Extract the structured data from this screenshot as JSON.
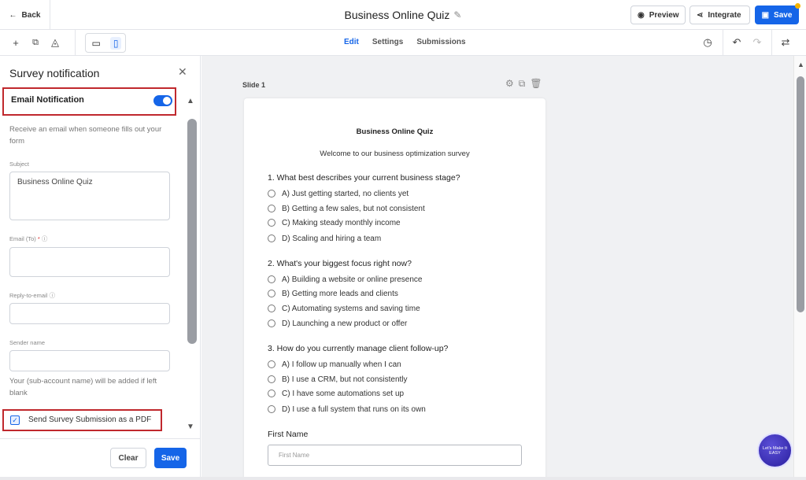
{
  "topbar": {
    "back_label": "Back",
    "title": "Business Online Quiz",
    "preview_label": "Preview",
    "integrate_label": "Integrate",
    "save_label": "Save"
  },
  "toolbar": {
    "tabs": [
      {
        "label": "Edit",
        "active": true
      },
      {
        "label": "Settings",
        "active": false
      },
      {
        "label": "Submissions",
        "active": false
      }
    ]
  },
  "panel": {
    "title": "Survey notification",
    "email_notification_label": "Email Notification",
    "email_notification_on": true,
    "description": "Receive an email when someone fills out your form",
    "subject_label": "Subject",
    "subject_value": "Business Online Quiz",
    "email_to_label": "Email (To)",
    "email_to_required": "*",
    "reply_to_label": "Reply-to-email",
    "sender_name_label": "Sender name",
    "sender_note": "Your (sub-account name) will be added if left blank",
    "pdf_label": "Send Survey Submission as a PDF",
    "pdf_checked": true,
    "clear_label": "Clear",
    "save_label": "Save"
  },
  "canvas": {
    "slide_label": "Slide 1",
    "form_title": "Business Online Quiz",
    "form_subtitle": "Welcome to our business optimization survey",
    "questions": [
      {
        "text": "1. What best describes your current business stage?",
        "options": [
          "A) Just getting started, no clients yet",
          "B) Getting a few sales, but not consistent",
          "C) Making steady monthly income",
          "D) Scaling and hiring a team"
        ]
      },
      {
        "text": "2. What's your biggest focus right now?",
        "options": [
          "A) Building a website or online presence",
          "B) Getting more leads and clients",
          "C) Automating systems and saving time",
          "D) Launching a new product or offer"
        ]
      },
      {
        "text": "3. How do you currently manage client follow-up?",
        "options": [
          "A) I follow up manually when I can",
          "B) I use a CRM, but not consistently",
          "C) I have some automations set up",
          "D) I use a full system that runs on its own"
        ]
      }
    ],
    "first_name_label": "First Name",
    "first_name_placeholder": "First Name"
  },
  "badge": {
    "text": "Let's Make It EASY"
  },
  "colors": {
    "primary": "#1565e8",
    "highlight": "#c0282d",
    "canvas_bg": "#f0f1f3"
  },
  "icons": [
    "back-arrow-icon",
    "pencil-icon",
    "eye-icon",
    "share-icon",
    "save-disk-icon",
    "plus-icon",
    "layers-icon",
    "paint-drop-icon",
    "desktop-icon",
    "mobile-icon",
    "history-icon",
    "undo-icon",
    "redo-icon",
    "swap-icon",
    "close-icon",
    "settings-icon",
    "copy-icon",
    "trash-icon",
    "info-icon",
    "check-icon",
    "scroll-up-icon",
    "scroll-down-icon"
  ]
}
